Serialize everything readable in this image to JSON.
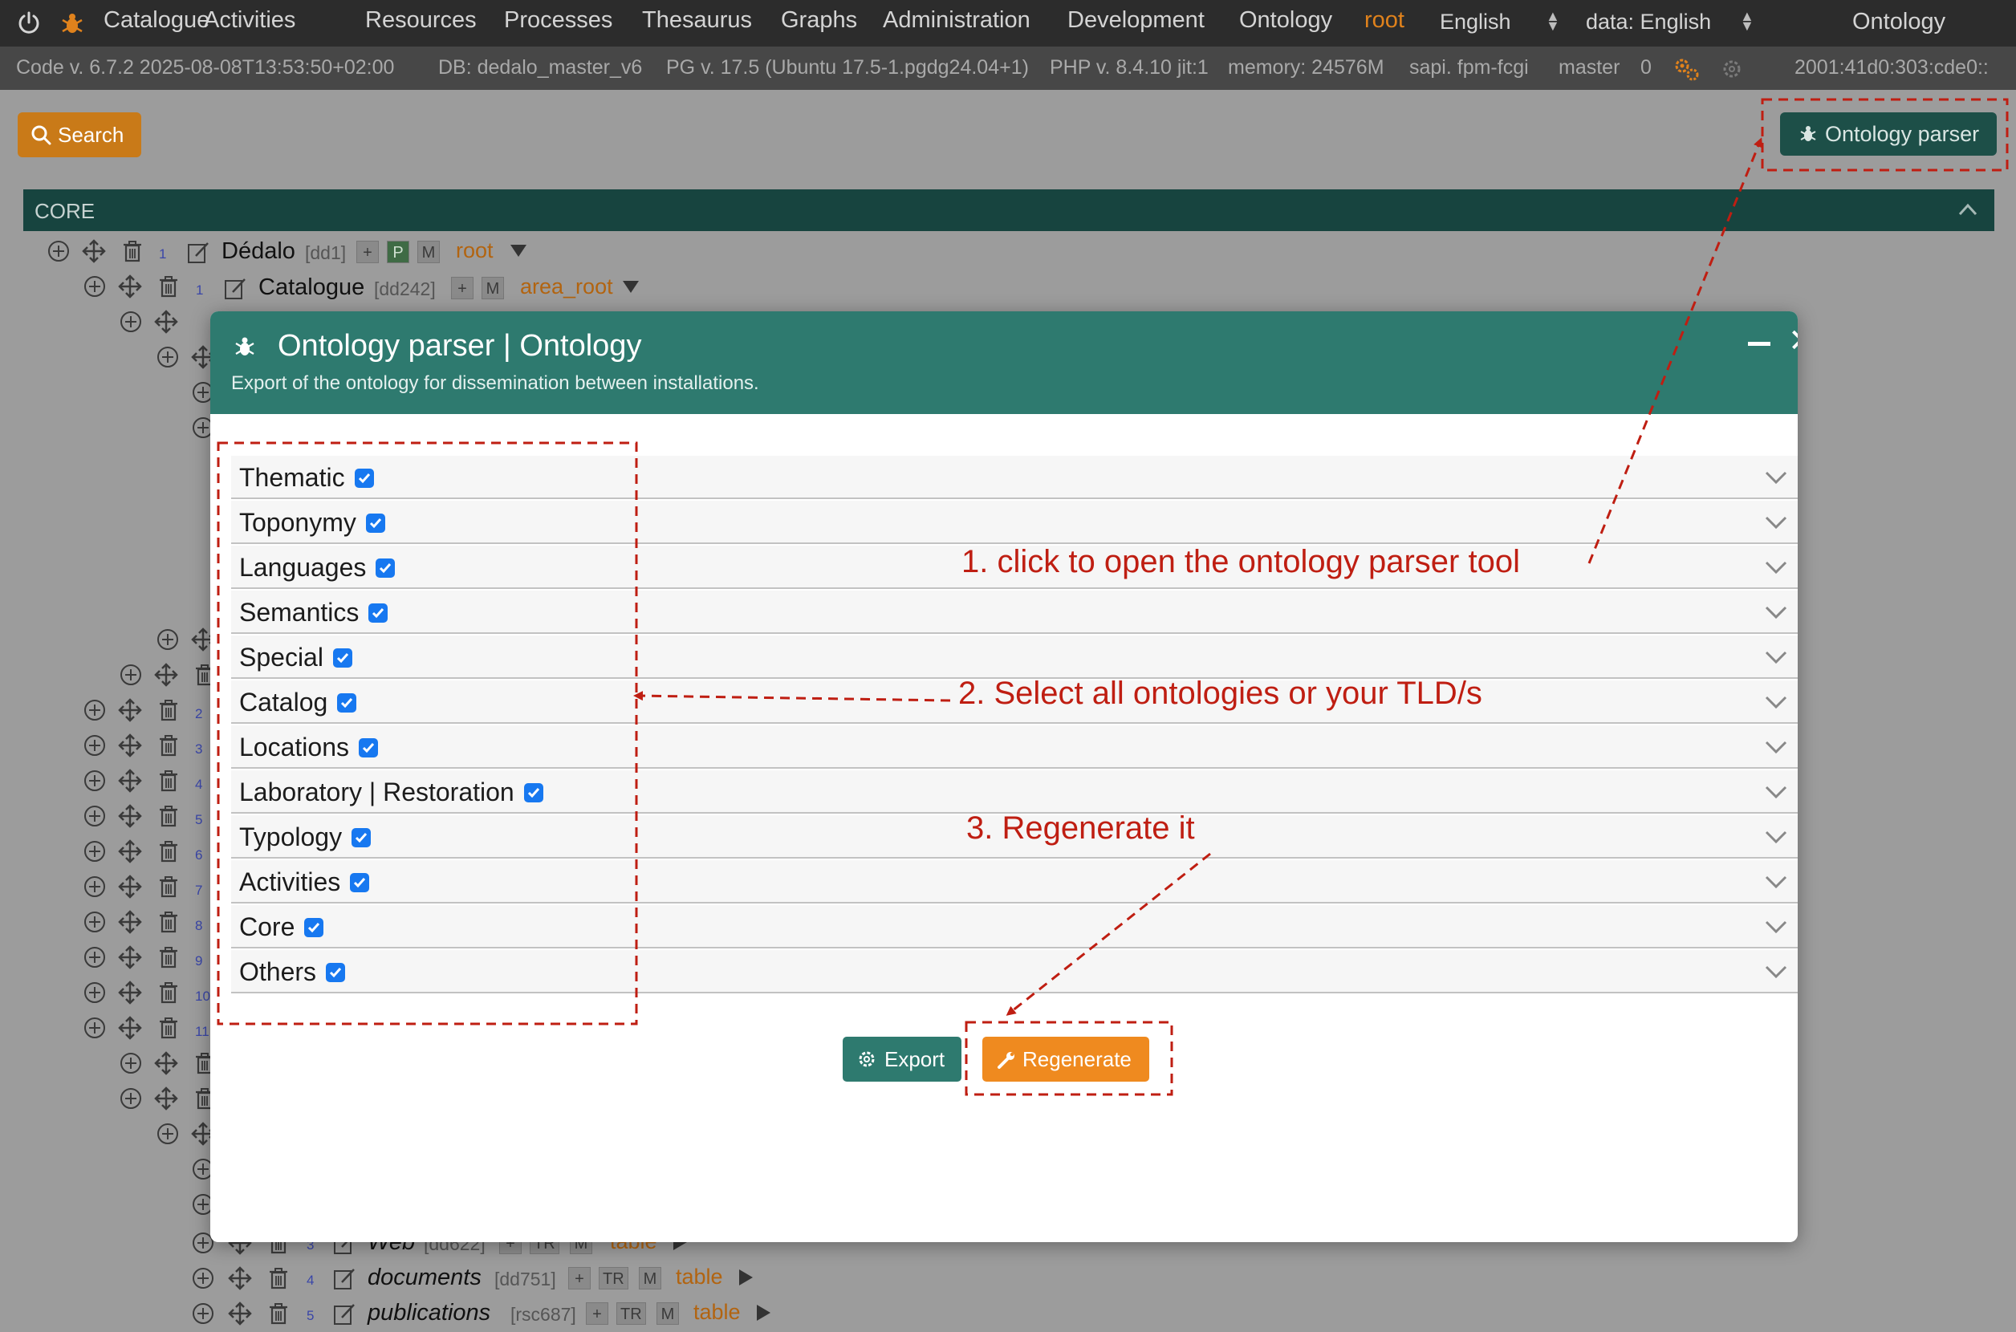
{
  "menu": {
    "items": [
      "Catalogue",
      "Activities",
      "Resources",
      "Processes",
      "Thesaurus",
      "Graphs",
      "Administration",
      "Development",
      "Ontology"
    ],
    "user": "root",
    "lang": "English",
    "data_lang": "data: English",
    "title": "Ontology"
  },
  "info": {
    "code": "Code v. 6.7.2 2025-08-08T13:53:50+02:00",
    "db": "DB: dedalo_master_v6",
    "pg": "PG v. 17.5 (Ubuntu 17.5-1.pgdg24.04+1)",
    "php": "PHP v. 8.4.10 jit:1",
    "memory": "memory: 24576M",
    "sapi": "sapi. fpm-fcgi",
    "branch": "master",
    "count": "0",
    "ip": "2001:41d0:303:cde0::"
  },
  "page": {
    "search_label": "Search",
    "parser_label": "Ontology parser",
    "section_label": "CORE"
  },
  "tree": {
    "row1": {
      "num": "1",
      "label": "Dédalo",
      "tid": "[dd1]",
      "b1": "+",
      "b2": "P",
      "b3": "M",
      "model": "root"
    },
    "row2": {
      "num": "1",
      "label": "Catalogue",
      "tid": "[dd242]",
      "b1": "+",
      "b2": "M",
      "model": "area_root"
    },
    "row3": {
      "num": "3",
      "label": "Web",
      "tid": "[dd622]",
      "b1": "+",
      "b2": "TR",
      "b3": "M",
      "model": "table"
    },
    "row4": {
      "num": "4",
      "label": "documents",
      "tid": "[dd751]",
      "b1": "+",
      "b2": "TR",
      "b3": "M",
      "model": "table"
    },
    "row5": {
      "num": "5",
      "label": "publications",
      "tid": "[rsc687]",
      "b1": "+",
      "b2": "TR",
      "b3": "M",
      "model": "table"
    },
    "side_nums": [
      "2",
      "3",
      "4",
      "5",
      "6",
      "7",
      "8",
      "9",
      "10",
      "11"
    ]
  },
  "modal": {
    "title": "Ontology parser | Ontology",
    "subtitle": "Export of the ontology for dissemination between installations.",
    "ontologies": [
      {
        "label": "Thematic",
        "checked": true
      },
      {
        "label": "Toponymy",
        "checked": true
      },
      {
        "label": "Languages",
        "checked": true
      },
      {
        "label": "Semantics",
        "checked": true
      },
      {
        "label": "Special",
        "checked": true
      },
      {
        "label": "Catalog",
        "checked": true
      },
      {
        "label": "Locations",
        "checked": true
      },
      {
        "label": "Laboratory | Restoration",
        "checked": true
      },
      {
        "label": "Typology",
        "checked": true
      },
      {
        "label": "Activities",
        "checked": true
      },
      {
        "label": "Core",
        "checked": true
      },
      {
        "label": "Others",
        "checked": true
      }
    ],
    "export_label": "Export",
    "regenerate_label": "Regenerate"
  },
  "annotations": {
    "step1": "1. click to open the ontology parser tool",
    "step2": "2. Select all ontologies or your TLD/s",
    "step3": "3. Regenerate it"
  },
  "colors": {
    "teal": "#2e7a6f",
    "orange": "#ef8a1f",
    "annotation_red": "#bf1e12",
    "checkbox_blue": "#1778f0"
  }
}
